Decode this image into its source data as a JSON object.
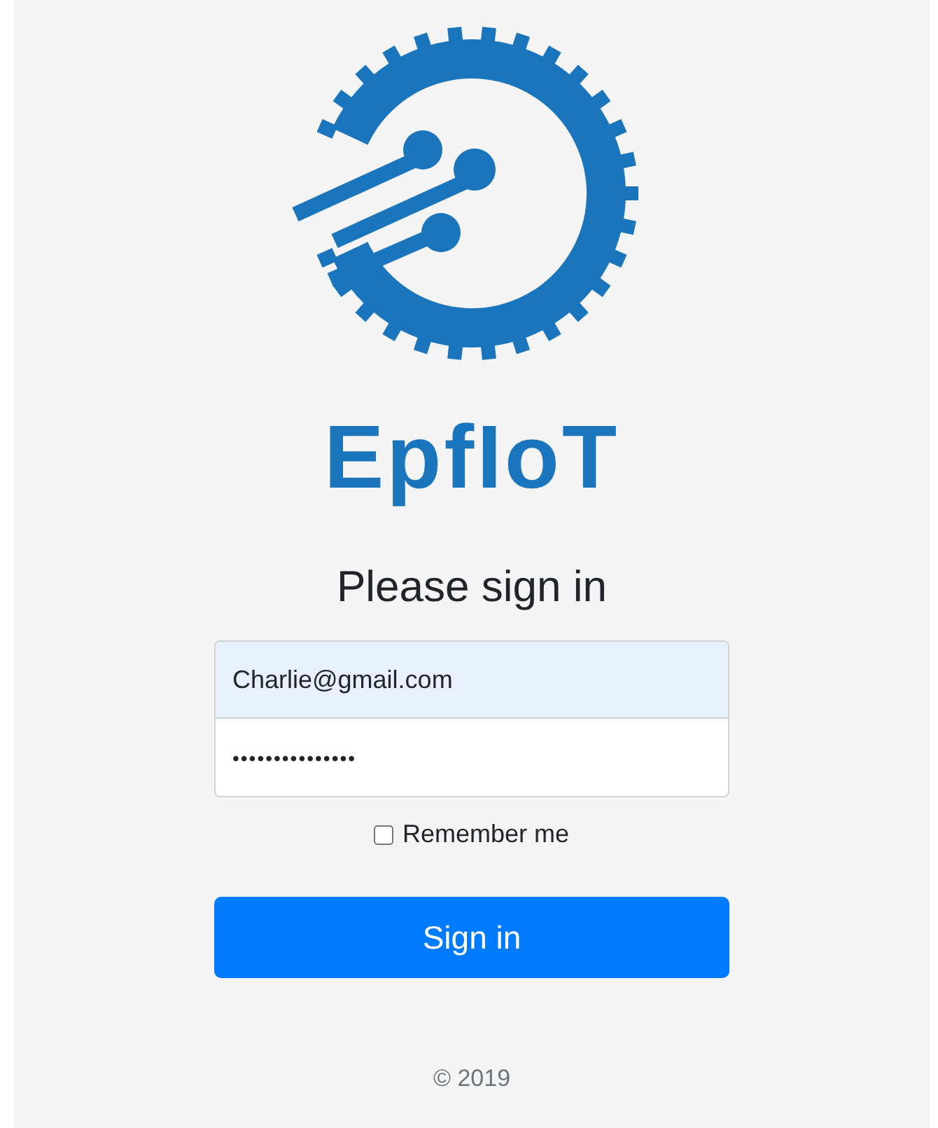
{
  "brand": {
    "name": "EpfIoT"
  },
  "heading": "Please sign in",
  "email_field": {
    "value": "Charlie@gmail.com"
  },
  "password_field": {
    "value": "•••••••••••••••"
  },
  "remember_me": {
    "label": "Remember me",
    "checked": false
  },
  "sign_in_button": "Sign in",
  "footer": "© 2019"
}
